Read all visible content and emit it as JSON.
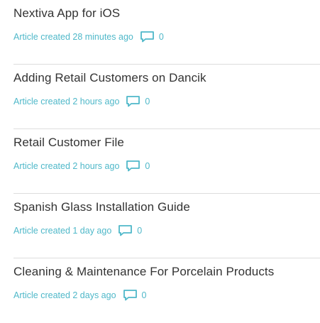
{
  "articles": [
    {
      "title": "Nextiva App for iOS",
      "created": "Article created 28 minutes ago",
      "comments": "0"
    },
    {
      "title": "Adding Retail Customers on Dancik",
      "created": "Article created 2 hours ago",
      "comments": "0"
    },
    {
      "title": "Retail Customer File",
      "created": "Article created 2 hours ago",
      "comments": "0"
    },
    {
      "title": "Spanish Glass Installation Guide",
      "created": "Article created 1 day ago",
      "comments": "0"
    },
    {
      "title": "Cleaning & Maintenance For Porcelain Products",
      "created": "Article created 2 days ago",
      "comments": "0"
    }
  ],
  "colors": {
    "title": "#333333",
    "meta": "#4fb8c9",
    "divider": "#dddddd"
  },
  "icons": {
    "comment": "comment-bubble-icon"
  }
}
